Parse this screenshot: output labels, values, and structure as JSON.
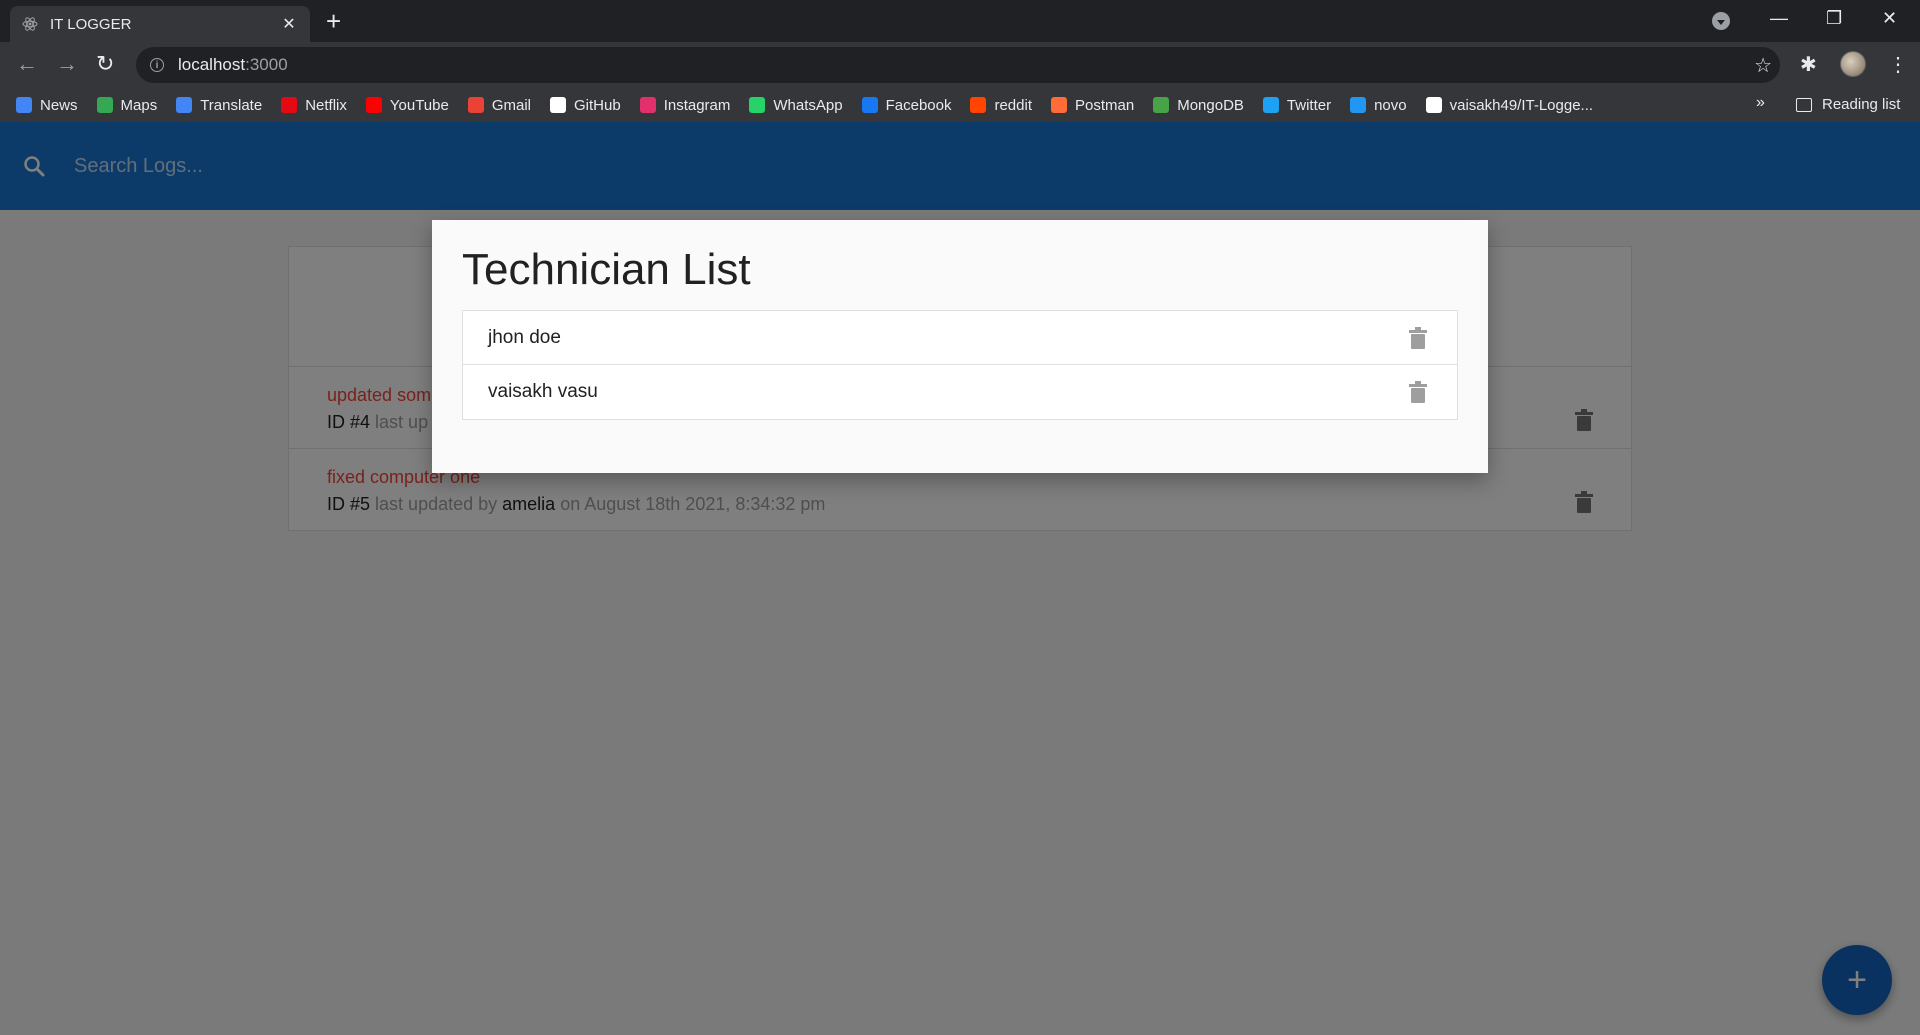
{
  "browser": {
    "tab_title": "IT LOGGER",
    "tab_close": "✕",
    "new_tab": "+",
    "url_host": "localhost",
    "url_rest": ":3000",
    "window_controls": {
      "minimize": "—",
      "restore": "❐",
      "close": "✕"
    },
    "nav": {
      "back": "←",
      "forward": "→",
      "reload": "↻"
    },
    "star": "☆",
    "extensions": "✱",
    "menu": "⋮",
    "bookmarks": [
      {
        "label": "News",
        "icon": "news-icon",
        "color": "#4285f4"
      },
      {
        "label": "Maps",
        "icon": "maps-icon",
        "color": "#34a853"
      },
      {
        "label": "Translate",
        "icon": "translate-icon",
        "color": "#4285f4"
      },
      {
        "label": "Netflix",
        "icon": "netflix-icon",
        "color": "#e50914"
      },
      {
        "label": "YouTube",
        "icon": "youtube-icon",
        "color": "#ff0000"
      },
      {
        "label": "Gmail",
        "icon": "gmail-icon",
        "color": "#ea4335"
      },
      {
        "label": "GitHub",
        "icon": "github-icon",
        "color": "#ffffff"
      },
      {
        "label": "Instagram",
        "icon": "instagram-icon",
        "color": "#e1306c"
      },
      {
        "label": "WhatsApp",
        "icon": "whatsapp-icon",
        "color": "#25d366"
      },
      {
        "label": "Facebook",
        "icon": "facebook-icon",
        "color": "#1877f2"
      },
      {
        "label": "reddit",
        "icon": "reddit-icon",
        "color": "#ff4500"
      },
      {
        "label": "Postman",
        "icon": "postman-icon",
        "color": "#ff6c37"
      },
      {
        "label": "MongoDB",
        "icon": "mongodb-icon",
        "color": "#47a248"
      },
      {
        "label": "Twitter",
        "icon": "twitter-icon",
        "color": "#1da1f2"
      },
      {
        "label": "novo",
        "icon": "novo-icon",
        "color": "#2196f3"
      },
      {
        "label": "vaisakh49/IT-Logge...",
        "icon": "github-icon",
        "color": "#ffffff"
      }
    ],
    "bookmarks_more": "»",
    "reading_list": "Reading list"
  },
  "app": {
    "search_placeholder": "Search Logs...",
    "logs": [
      {
        "message": "updated som",
        "id": "ID #4",
        "meta_rest": "last up",
        "tech": "",
        "date": ""
      },
      {
        "message": "fixed computer one",
        "id": "ID #5",
        "meta_rest": "last updated by",
        "tech": "amelia",
        "date": "on August 18th 2021, 8:34:32 pm"
      }
    ],
    "fab_label": "+"
  },
  "modal": {
    "title": "Technician List",
    "technicians": [
      "jhon doe",
      "vaisakh vasu"
    ]
  },
  "colors": {
    "app_bar": "#1976d2",
    "fab": "#1565c0",
    "log_message": "#f44336"
  }
}
